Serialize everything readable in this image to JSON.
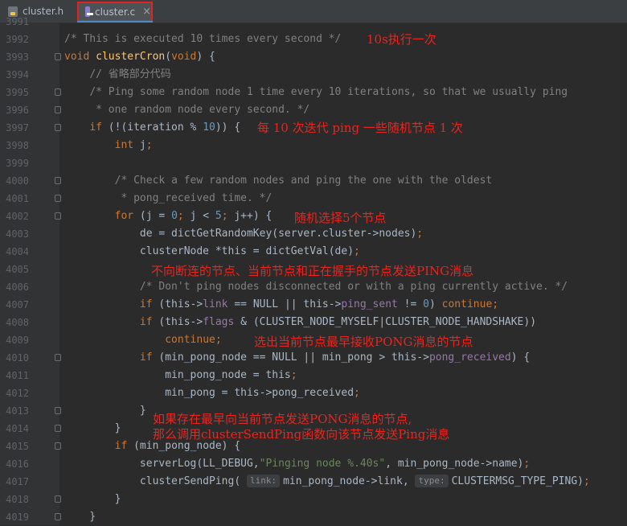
{
  "tabs": [
    {
      "label": "cluster.h",
      "close": "×"
    },
    {
      "label": "cluster.c",
      "close": "×"
    }
  ],
  "partial_top_line": "3991",
  "lines": [
    {
      "n": "3992",
      "html": "<span class=\"cm\">/* This is executed 10 times every second */</span>"
    },
    {
      "n": "3993",
      "html": "<span class=\"kw\">void</span> <span class=\"fn\">clusterCron</span>(<span class=\"kw\">void</span>) {"
    },
    {
      "n": "3994",
      "html": "    <span class=\"cm\">// 省略部分代码</span>"
    },
    {
      "n": "3995",
      "html": "    <span class=\"cm\">/* Ping some random node 1 time every 10 iterations, so that we usually ping</span>"
    },
    {
      "n": "3996",
      "html": "<span class=\"cm\">     * one random node every second. */</span>"
    },
    {
      "n": "3997",
      "html": "    <span class=\"kw\">if</span> (!(iteration % <span class=\"num\">10</span>)) {"
    },
    {
      "n": "3998",
      "html": "        <span class=\"kw\">int</span> j<span class=\"kw\">;</span>"
    },
    {
      "n": "3999",
      "html": ""
    },
    {
      "n": "4000",
      "html": "        <span class=\"cm\">/* Check a few random nodes and ping the one with the oldest</span>"
    },
    {
      "n": "4001",
      "html": "<span class=\"cm\">         * pong_received time. */</span>"
    },
    {
      "n": "4002",
      "html": "        <span class=\"kw\">for</span> (j = <span class=\"num\">0</span><span class=\"kw\">;</span> j &lt; <span class=\"num\">5</span><span class=\"kw\">;</span> j++) {"
    },
    {
      "n": "4003",
      "html": "            de = dictGetRandomKey(server.cluster-&gt;nodes)<span class=\"kw\">;</span>"
    },
    {
      "n": "4004",
      "html": "            clusterNode *this = dictGetVal(de)<span class=\"kw\">;</span>"
    },
    {
      "n": "4005",
      "html": ""
    },
    {
      "n": "4006",
      "html": "            <span class=\"cm\">/* Don't ping nodes disconnected or with a ping currently active. */</span>"
    },
    {
      "n": "4007",
      "html": "            <span class=\"kw\">if</span> (this-&gt;<span class=\"fld\">link</span> == NULL || this-&gt;<span class=\"fld\">ping_sent</span> != <span class=\"num\">0</span>) <span class=\"kw\">continue;</span>"
    },
    {
      "n": "4008",
      "html": "            <span class=\"kw\">if</span> (this-&gt;<span class=\"fld\">flags</span> &amp; (CLUSTER_NODE_MYSELF|CLUSTER_NODE_HANDSHAKE))"
    },
    {
      "n": "4009",
      "html": "                <span class=\"kw\">continue;</span>"
    },
    {
      "n": "4010",
      "html": "            <span class=\"kw\">if</span> (min_pong_node == NULL || min_pong &gt; this-&gt;<span class=\"fld\">pong_received</span>) {"
    },
    {
      "n": "4011",
      "html": "                min_pong_node = this<span class=\"kw\">;</span>"
    },
    {
      "n": "4012",
      "html": "                min_pong = this-&gt;pong_received<span class=\"kw\">;</span>"
    },
    {
      "n": "4013",
      "html": "            }"
    },
    {
      "n": "4014",
      "html": "        }"
    },
    {
      "n": "4015",
      "html": "        <span class=\"kw\">if</span> (min_pong_node) {"
    },
    {
      "n": "4016",
      "html": "            serverLog(LL_DEBUG,<span class=\"str\">\"Pinging node %.40s\"</span>, min_pong_node-&gt;name)<span class=\"kw\">;</span>"
    },
    {
      "n": "4017",
      "html": "            clusterSendPing( <span class=\"hint\">link:</span>min_pong_node-&gt;link, <span class=\"hint\">type:</span>CLUSTERMSG_TYPE_PING)<span class=\"kw\">;</span>"
    },
    {
      "n": "4018",
      "html": "        }"
    },
    {
      "n": "4019",
      "html": "    }"
    }
  ],
  "annotations": {
    "a1": "10s执行一次",
    "a2": "每 10 次迭代 ping 一些随机节点 1 次",
    "a3": "随机选择5个节点",
    "a4": "不向断连的节点、当前节点和正在握手的节点发送PING消息",
    "a5": "选出当前节点最早接收PONG消息的节点",
    "a6": "如果存在最早向当前节点发送PONG消息的节点,",
    "a7": "那么调用clusterSendPing函数向该节点发送Ping消息"
  },
  "colors": {
    "background": "#2b2b2b",
    "annotation": "#e8251f",
    "keyword": "#cc7832",
    "function": "#ffc66d",
    "comment": "#808080"
  }
}
